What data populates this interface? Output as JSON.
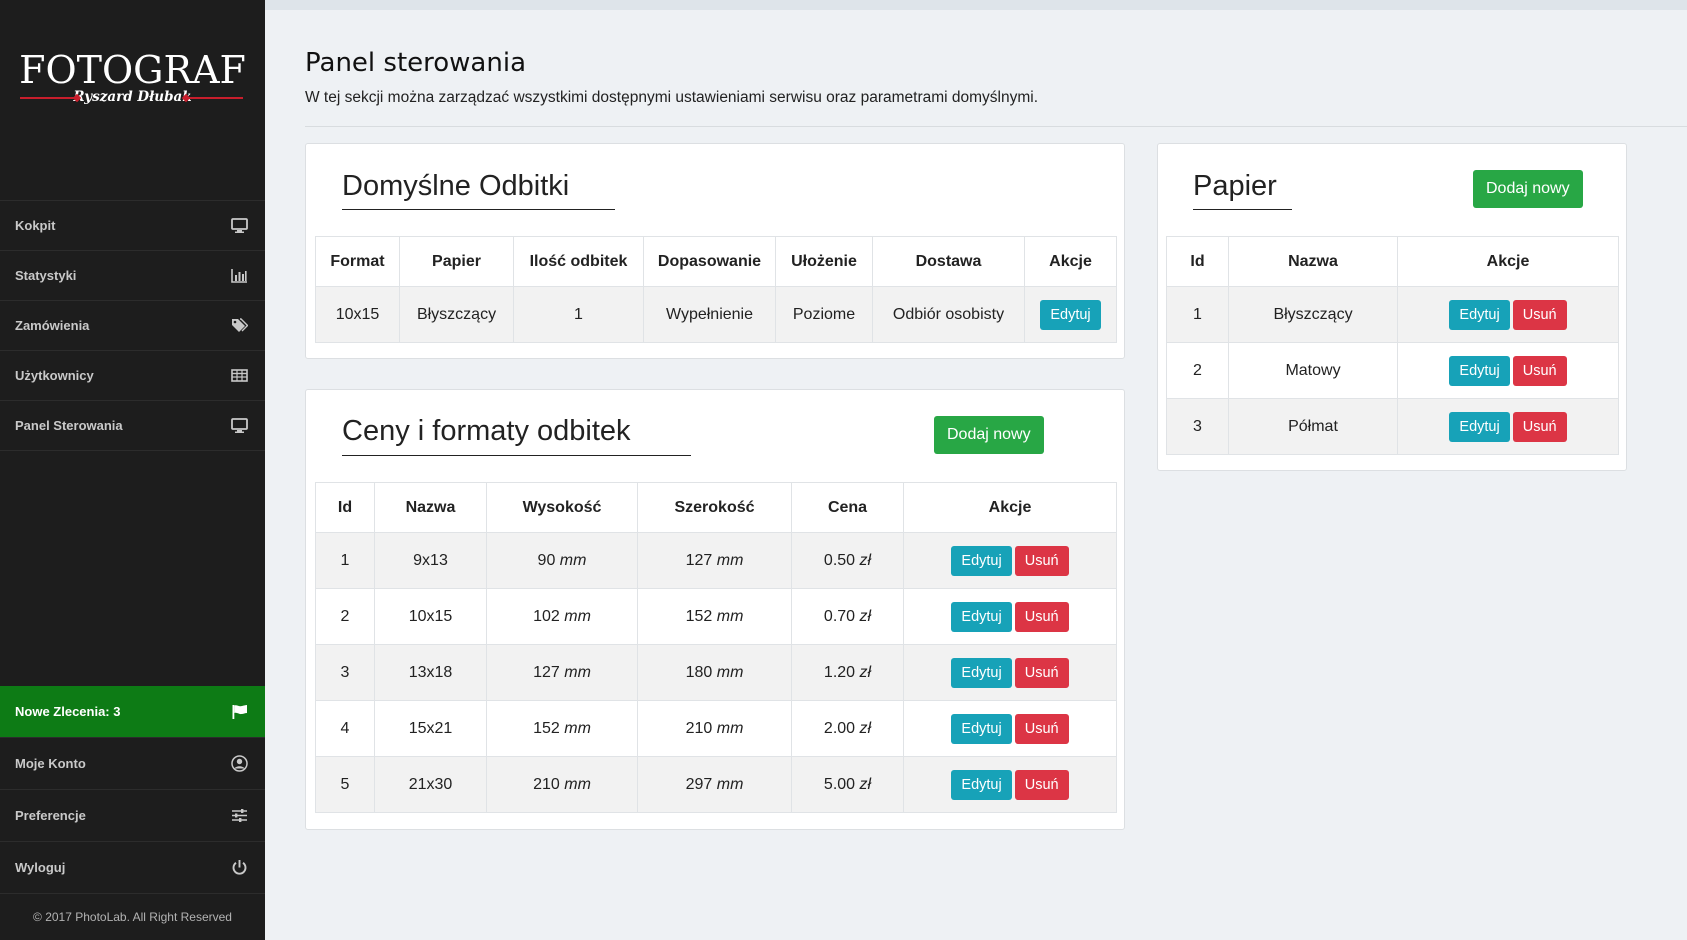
{
  "sidebar": {
    "logo_title": "FOTOGRAF",
    "logo_subtitle": "Ryszard Dłubak",
    "items": [
      {
        "label": "Kokpit",
        "icon": "monitor-icon"
      },
      {
        "label": "Statystyki",
        "icon": "bar-chart-icon"
      },
      {
        "label": "Zamówienia",
        "icon": "tags-icon"
      },
      {
        "label": "Użytkownicy",
        "icon": "table-icon"
      },
      {
        "label": "Panel Sterowania",
        "icon": "monitor-icon"
      }
    ],
    "bottom_items": [
      {
        "label": "Nowe Zlecenia: 3",
        "icon": "flag-icon"
      },
      {
        "label": "Moje Konto",
        "icon": "user-circle-icon"
      },
      {
        "label": "Preferencje",
        "icon": "sliders-icon"
      },
      {
        "label": "Wyloguj",
        "icon": "power-icon"
      }
    ],
    "copyright": "© 2017 PhotoLab. All Right Reserved"
  },
  "header": {
    "title": "Panel sterowania",
    "description": "W tej sekcji można zarządzać wszystkimi dostępnymi ustawieniami serwisu oraz parametrami domyślnymi."
  },
  "defaults_card": {
    "title": "Domyślne Odbitki",
    "columns": [
      "Format",
      "Papier",
      "Ilość odbitek",
      "Dopasowanie",
      "Ułożenie",
      "Dostawa",
      "Akcje"
    ],
    "row": {
      "format": "10x15",
      "paper": "Błyszczący",
      "count": "1",
      "fit": "Wypełnienie",
      "orientation": "Poziome",
      "delivery": "Odbiór osobisty"
    },
    "edit_label": "Edytuj"
  },
  "prices_card": {
    "title": "Ceny i formaty odbitek",
    "add_label": "Dodaj nowy",
    "columns": [
      "Id",
      "Nazwa",
      "Wysokość",
      "Szerokość",
      "Cena",
      "Akcje"
    ],
    "rows": [
      {
        "id": "1",
        "name": "9x13",
        "height": "90",
        "width": "127",
        "price": "0.50"
      },
      {
        "id": "2",
        "name": "10x15",
        "height": "102",
        "width": "152",
        "price": "0.70"
      },
      {
        "id": "3",
        "name": "13x18",
        "height": "127",
        "width": "180",
        "price": "1.20"
      },
      {
        "id": "4",
        "name": "15x21",
        "height": "152",
        "width": "210",
        "price": "2.00"
      },
      {
        "id": "5",
        "name": "21x30",
        "height": "210",
        "width": "297",
        "price": "5.00"
      }
    ],
    "unit_mm": "mm",
    "unit_currency": "zł",
    "edit_label": "Edytuj",
    "delete_label": "Usuń"
  },
  "paper_card": {
    "title": "Papier",
    "add_label": "Dodaj nowy",
    "columns": [
      "Id",
      "Nazwa",
      "Akcje"
    ],
    "rows": [
      {
        "id": "1",
        "name": "Błyszczący"
      },
      {
        "id": "2",
        "name": "Matowy"
      },
      {
        "id": "3",
        "name": "Półmat"
      }
    ],
    "edit_label": "Edytuj",
    "delete_label": "Usuń"
  },
  "colors": {
    "sidebar_bg": "#1d1d1d",
    "active_item": "#0d7b15",
    "edit_button": "#17a2b8",
    "delete_button": "#dc3545",
    "add_button": "#28a745"
  }
}
